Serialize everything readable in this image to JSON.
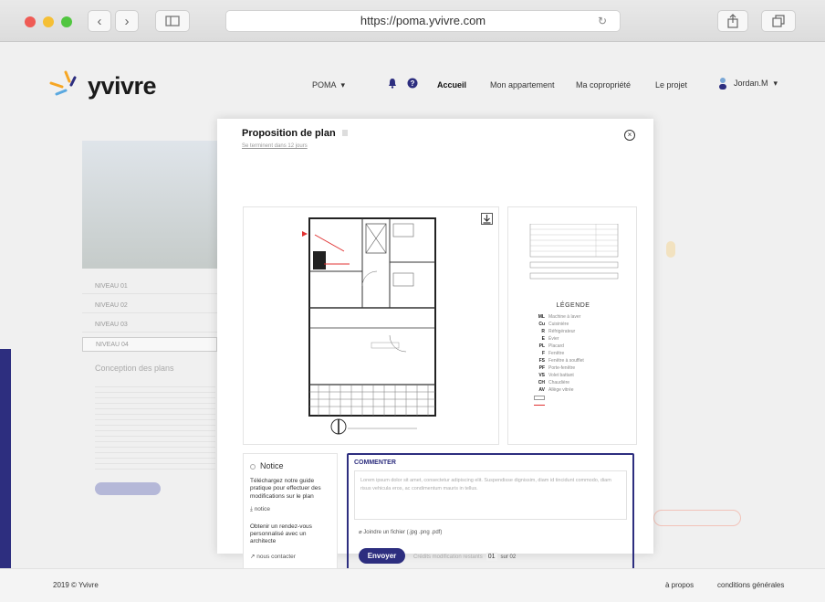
{
  "browser": {
    "url": "https://poma.yvivre.com",
    "nav_back": "‹",
    "nav_forward": "›"
  },
  "header": {
    "logo_text": "yvivre",
    "project_select": "POMA",
    "nav": [
      "Accueil",
      "Mon appartement",
      "Ma copropriété",
      "Le projet"
    ],
    "user": "Jordan.M"
  },
  "background": {
    "levels": [
      "NIVEAU 01",
      "NIVEAU 02",
      "NIVEAU 03",
      "NIVEAU 04"
    ],
    "section_title": "Conception des plans"
  },
  "modal": {
    "title": "Proposition de plan",
    "subtitle": "Se terminent dans 12 jours",
    "notice": {
      "title": "Notice",
      "text": "Téléchargez notre guide pratique pour effectuer des modifications sur le plan",
      "link": "notice",
      "rdv_text": "Obtenir un rendez-vous personnalisé avec un architecte",
      "contact_link": "nous contacter"
    },
    "comment": {
      "title": "COMMENTER",
      "placeholder": "Lorem ipsum dolor sit amet, consectetur adipiscing elit. Suspendisse dignissim, diam id tincidunt commodo, diam risus vehicula eros, ac condimentum mauris in tellus.",
      "attach": "Joindre un fichier (.jpg .png .pdf)",
      "send": "Envoyer",
      "credits_label": "Crédits modification restants",
      "credits_value": "01",
      "credits_total": "sur 02"
    },
    "legend": {
      "title": "LÉGENDE",
      "items": [
        {
          "code": "ML",
          "label": "Machine à laver"
        },
        {
          "code": "Cu",
          "label": "Cuisinière"
        },
        {
          "code": "R",
          "label": "Réfrigérateur"
        },
        {
          "code": "E",
          "label": "Évier"
        },
        {
          "code": "PL",
          "label": "Placard"
        },
        {
          "code": "F",
          "label": "Fenêtre"
        },
        {
          "code": "FS",
          "label": "Fenêtre à soufflet"
        },
        {
          "code": "PF",
          "label": "Porte-fenêtre"
        },
        {
          "code": "VS",
          "label": "Volet battant"
        },
        {
          "code": "CH",
          "label": "Chaudière"
        },
        {
          "code": "AV",
          "label": "Allège vitrée"
        }
      ]
    }
  },
  "footer": {
    "copyright": "2019 © Yvivre",
    "links": [
      "à propos",
      "conditions générales"
    ]
  },
  "colors": {
    "accent": "#2d2e7f",
    "plan_red": "#e03030"
  }
}
